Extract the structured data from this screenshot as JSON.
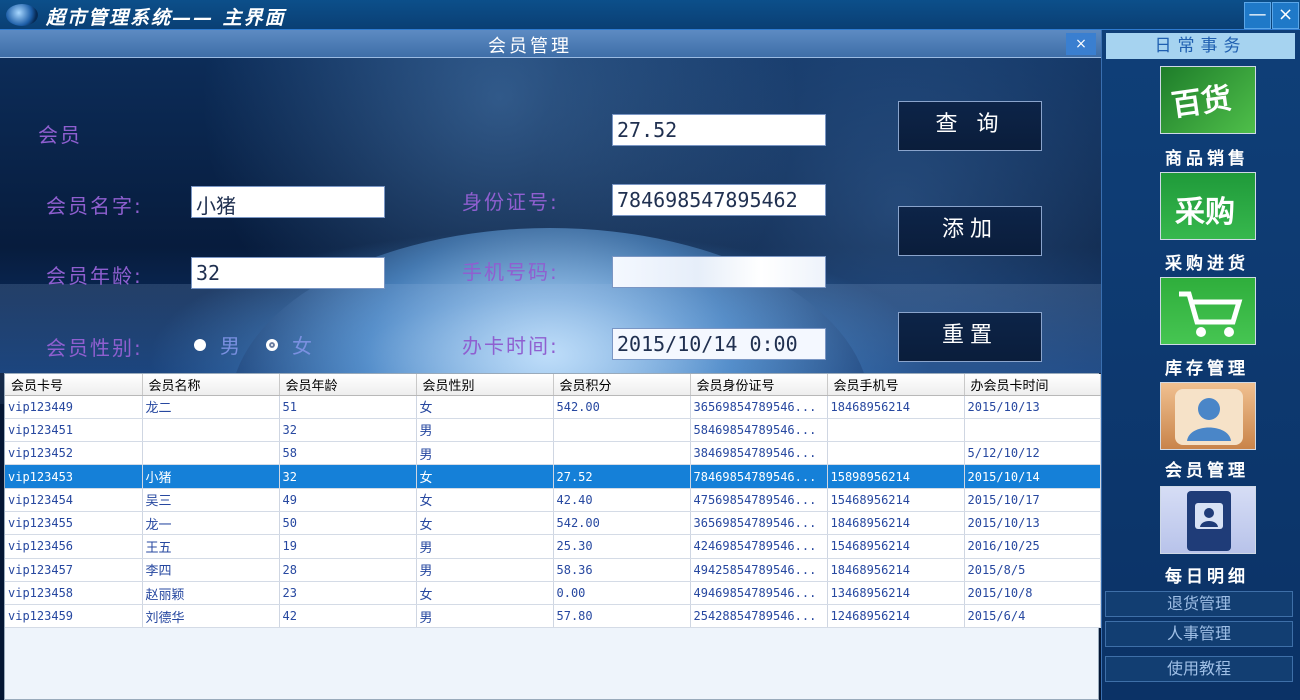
{
  "window": {
    "title": "超市管理系统—— 主界面",
    "minimize": "—",
    "close": "×"
  },
  "panel": {
    "title": "会员管理",
    "close": "×",
    "form": {
      "member_label": "会员",
      "points_value": "27.52",
      "name_label": "会员名字:",
      "name_value": "小猪",
      "id_label": "身份证号:",
      "id_value": "784698547895462",
      "age_label": "会员年龄:",
      "age_value": "32",
      "phone_label": "手机号码:",
      "phone_value": "",
      "gender_label": "会员性别:",
      "gender_male": "男",
      "gender_female": "女",
      "gender_selected": "男",
      "card_time_label": "办卡时间:",
      "card_time_value": "2015/10/14 0:00"
    },
    "buttons": {
      "query": "查 询",
      "add": "添加",
      "reset": "重置"
    },
    "table": {
      "columns": [
        "会员卡号",
        "会员名称",
        "会员年龄",
        "会员性别",
        "会员积分",
        "会员身份证号",
        "会员手机号",
        "办会员卡时间"
      ],
      "rows": [
        [
          "vip123449",
          "龙二",
          "51",
          "女",
          "542.00",
          "36569854789546...",
          "18468956214",
          "2015/10/13"
        ],
        [
          "vip123451",
          "",
          "32",
          "男",
          "",
          "58469854789546...",
          "",
          ""
        ],
        [
          "vip123452",
          "",
          "58",
          "男",
          "",
          "38469854789546...",
          "",
          "5/12/10/12"
        ],
        [
          "vip123453",
          "小猪",
          "32",
          "女",
          "27.52",
          "78469854789546...",
          "15898956214",
          "2015/10/14"
        ],
        [
          "vip123454",
          "吴三",
          "49",
          "女",
          "42.40",
          "47569854789546...",
          "15468956214",
          "2015/10/17"
        ],
        [
          "vip123455",
          "龙一",
          "50",
          "女",
          "542.00",
          "36569854789546...",
          "18468956214",
          "2015/10/13"
        ],
        [
          "vip123456",
          "王五",
          "19",
          "男",
          "25.30",
          "42469854789546...",
          "15468956214",
          "2016/10/25"
        ],
        [
          "vip123457",
          "李四",
          "28",
          "男",
          "58.36",
          "49425854789546...",
          "18468956214",
          "2015/8/5"
        ],
        [
          "vip123458",
          "赵丽颖",
          "23",
          "女",
          "0.00",
          "49469854789546...",
          "13468956214",
          "2015/10/8"
        ],
        [
          "vip123459",
          "刘德华",
          "42",
          "男",
          "57.80",
          "25428854789546...",
          "12468956214",
          "2015/6/4"
        ]
      ],
      "selected_row": 3
    }
  },
  "sidebar": {
    "header": "日常事务",
    "tiles": [
      {
        "label": "商品销售",
        "icon": "goods-icon",
        "icon_text": "百货",
        "color": "#2e9a3a"
      },
      {
        "label": "采购进货",
        "icon": "purchase-icon",
        "icon_text": "采购",
        "color": "#28a845"
      },
      {
        "label": "库存管理",
        "icon": "cart-icon",
        "color": "#3cb84a"
      },
      {
        "label": "会员管理",
        "icon": "member-icon",
        "color": "#e0a060"
      },
      {
        "label": "每日明细",
        "icon": "passbook-icon",
        "color": "#c9d2f2"
      }
    ],
    "buttons": [
      "退货管理",
      "人事管理",
      "使用教程"
    ]
  }
}
